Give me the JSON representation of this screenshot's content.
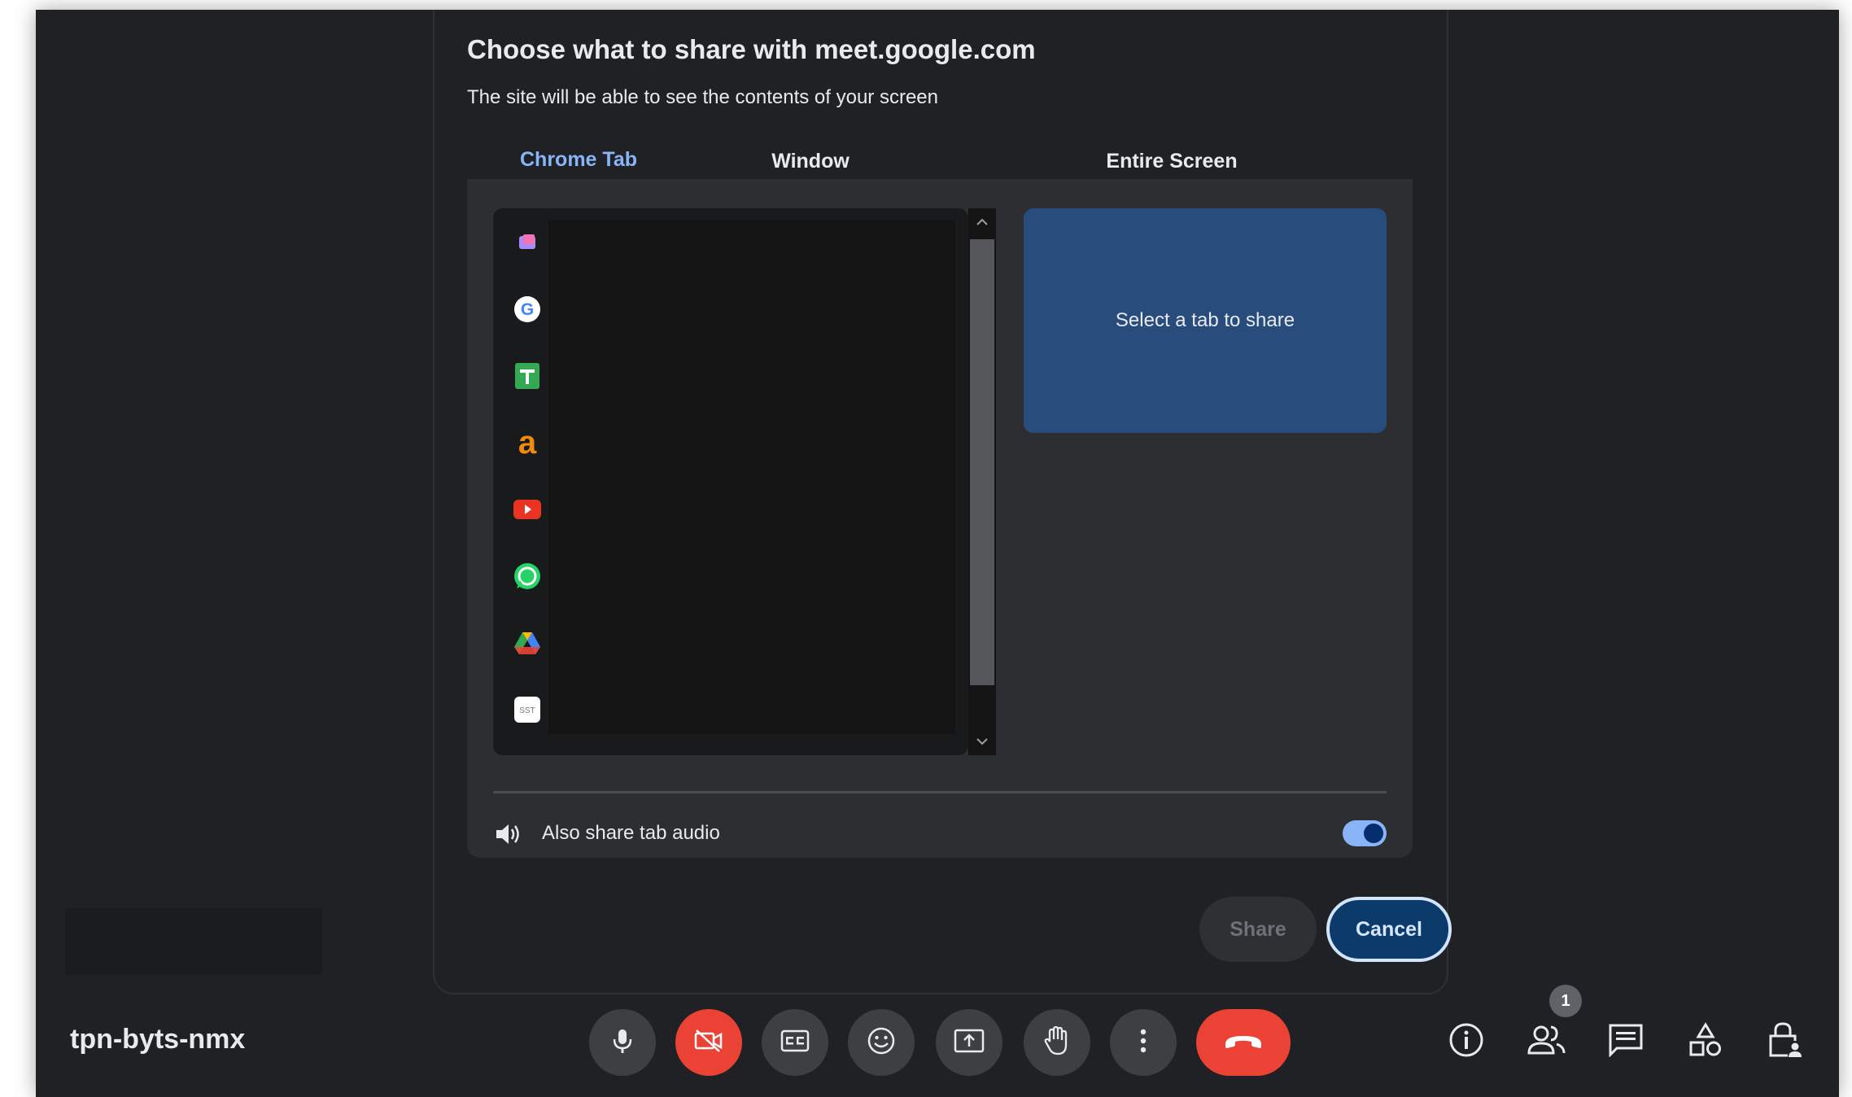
{
  "dialog": {
    "title": "Choose what to share with meet.google.com",
    "subtitle": "The site will be able to see the contents of your screen",
    "tabs": [
      {
        "label": "Chrome Tab",
        "active": true
      },
      {
        "label": "Window",
        "active": false
      },
      {
        "label": "Entire Screen",
        "active": false
      }
    ],
    "tab_icons": [
      "photos-icon",
      "google-icon",
      "sheets-icon",
      "amazon-icon",
      "youtube-icon",
      "whatsapp-icon",
      "drive-icon",
      "sst-icon"
    ],
    "sst_icon_text": "SST",
    "preview_text": "Select a tab to share",
    "audio_label": "Also share tab audio",
    "audio_enabled": true,
    "share_label": "Share",
    "cancel_label": "Cancel"
  },
  "meeting": {
    "code": "tpn-byts-nmx",
    "people_count": "1"
  },
  "colors": {
    "accent": "#8ab4f8",
    "end_call": "#ea4335",
    "preview_bg": "#284c7c"
  }
}
